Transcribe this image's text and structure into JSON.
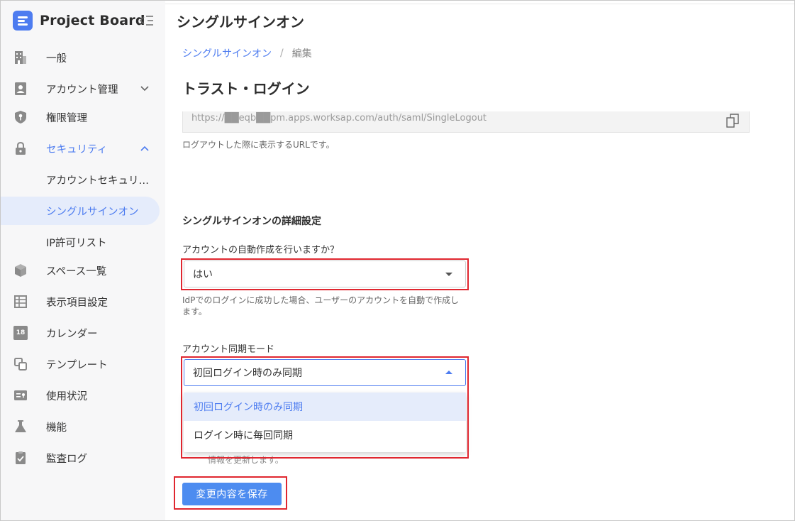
{
  "app": {
    "name": "Project Board"
  },
  "sidebar": {
    "items": [
      {
        "label": "一般",
        "icon": "building-icon"
      },
      {
        "label": "アカウント管理",
        "icon": "account-card-icon"
      },
      {
        "label": "権限管理",
        "icon": "shield-key-icon"
      },
      {
        "label": "セキュリティ",
        "icon": "lock-icon"
      },
      {
        "label": "アカウントセキュリテ…"
      },
      {
        "label": "シングルサインオン"
      },
      {
        "label": "IP許可リスト"
      },
      {
        "label": "スペース一覧",
        "icon": "cube-icon"
      },
      {
        "label": "表示項目設定",
        "icon": "table-icon"
      },
      {
        "label": "カレンダー",
        "icon": "calendar-icon",
        "badge": "18"
      },
      {
        "label": "テンプレート",
        "icon": "template-icon"
      },
      {
        "label": "使用状況",
        "icon": "usage-icon"
      },
      {
        "label": "機能",
        "icon": "flask-icon"
      },
      {
        "label": "監査ログ",
        "icon": "clipboard-check-icon"
      }
    ]
  },
  "header": {
    "title": "シングルサインオン"
  },
  "breadcrumb": {
    "parent": "シングルサインオン",
    "separator": "/",
    "current": "編集"
  },
  "main": {
    "section_title": "トラスト・ログイン",
    "logout_url": {
      "value": "https://██eqb██pm.apps.worksap.com/auth/saml/SingleLogout",
      "help": "ログアウトした際に表示するURLです。"
    },
    "advanced_title": "シングルサインオンの詳細設定",
    "auto_create": {
      "label": "アカウントの自動作成を行いますか？",
      "value": "はい",
      "help_line1": "IdPでのログインに成功した場合、ユーザーのアカウントを自動で作成し",
      "help_line2": "ます。"
    },
    "sync_mode": {
      "label": "アカウント同期モード",
      "value": "初回ログイン時のみ同期",
      "options": [
        "初回ログイン時のみ同期",
        "ログイン時に毎回同期"
      ],
      "hidden_help": "情報を更新します。"
    },
    "save_label": "変更内容を保存"
  },
  "colors": {
    "accent": "#4d7cf0",
    "highlight_box": "#e0262f",
    "selected_bg": "#e5ecfb"
  }
}
